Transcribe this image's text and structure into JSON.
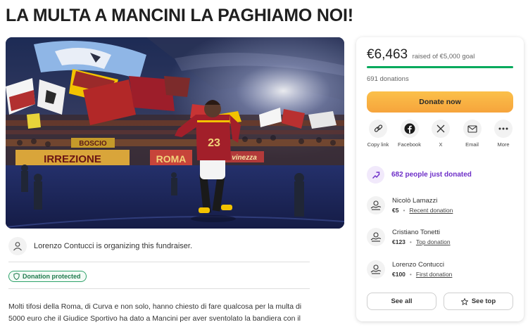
{
  "page": {
    "title": "LA MULTA A MANCINI LA PAGHIAMO NOI!"
  },
  "hero": {
    "banners": [
      "BOSCIO",
      "IRREZIONE",
      "ROMA",
      "vinezza"
    ],
    "shirt_number": "23"
  },
  "organizer": {
    "text": "Lorenzo Contucci is organizing this fundraiser."
  },
  "protection": {
    "label": "Donation protected"
  },
  "description": {
    "text": "Molti tifosi della Roma, di Curva e non solo, hanno chiesto di fare qualcosa per la multa di 5000 euro che il Giudice Sportivo ha dato a Mancini per aver sventolato la bandiera con il"
  },
  "donation_panel": {
    "raised": "€6,463",
    "goal_text": "raised of €5,000 goal",
    "progress_fraction": 1.0,
    "donation_count": "691 donations",
    "donate_label": "Donate now",
    "share_options": [
      {
        "label": "Copy link",
        "icon": "link-icon"
      },
      {
        "label": "Facebook",
        "icon": "facebook-icon"
      },
      {
        "label": "X",
        "icon": "x-logo-icon"
      },
      {
        "label": "Email",
        "icon": "mail-icon"
      },
      {
        "label": "More",
        "icon": "more-icon"
      }
    ],
    "just_donated": "682 people just donated",
    "donations": [
      {
        "name": "Nicolò Lamazzi",
        "amount": "€5",
        "tag": "Recent donation"
      },
      {
        "name": "Cristiano Tonetti",
        "amount": "€123",
        "tag": "Top donation"
      },
      {
        "name": "Lorenzo Contucci",
        "amount": "€100",
        "tag": "First donation"
      }
    ],
    "see_all_label": "See all",
    "see_top_label": "See top"
  },
  "colors": {
    "accent_green": "#02a95c",
    "donate_orange": "#f6a43c",
    "purple": "#6e2fc8",
    "protect_green": "#2fa36b"
  }
}
